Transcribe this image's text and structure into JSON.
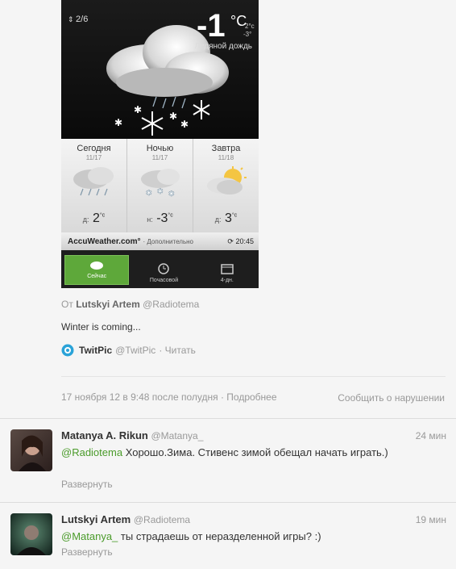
{
  "weather": {
    "page_indicator": "2/6",
    "temp": "-1",
    "unit": "°C",
    "hi": "2°c",
    "lo": "-3°",
    "condition": "Ледяной дождь",
    "forecast": [
      {
        "name": "Сегодня",
        "date": "11/17",
        "prefix": "д:",
        "temp": "2",
        "unit": "°c"
      },
      {
        "name": "Ночью",
        "date": "11/17",
        "prefix": "н:",
        "temp": "-3",
        "unit": "°c"
      },
      {
        "name": "Завтра",
        "date": "11/18",
        "prefix": "д:",
        "temp": "3",
        "unit": "°c"
      }
    ],
    "brand": "AccuWeather.com°",
    "brand_more": "· Дополнительно",
    "updated": "20:45",
    "tabs": [
      "Сейчас",
      "Почасовой",
      "4-дн."
    ]
  },
  "tweet": {
    "from_prefix": "От",
    "author": "Lutskyi Artem",
    "handle": "@Radiotema",
    "text": "Winter is coming...",
    "source_name": "TwitPic",
    "source_handle": "@TwitPic",
    "source_action": "· Читать",
    "timestamp": "17 ноября 12 в 9:48 после полудня",
    "details": "· Подробнее",
    "report": "Сообщить о нарушении"
  },
  "replies": [
    {
      "name": "Matanya A. Rikun",
      "handle": "@Matanya_",
      "time": "24 мин",
      "mention": "@Radiotema",
      "text": " Хорошо.Зима. Стивенс зимой обещал начать играть.)",
      "expand": "Развернуть"
    },
    {
      "name": "Lutskyi Artem",
      "handle": "@Radiotema",
      "time": "19 мин",
      "mention": "@Matanya_",
      "text": " ты страдаешь от неразделенной игры? :)",
      "expand": "Развернуть"
    }
  ],
  "colors": {
    "accent_green": "#4a9b2a",
    "tab_active": "#5ea83a"
  }
}
